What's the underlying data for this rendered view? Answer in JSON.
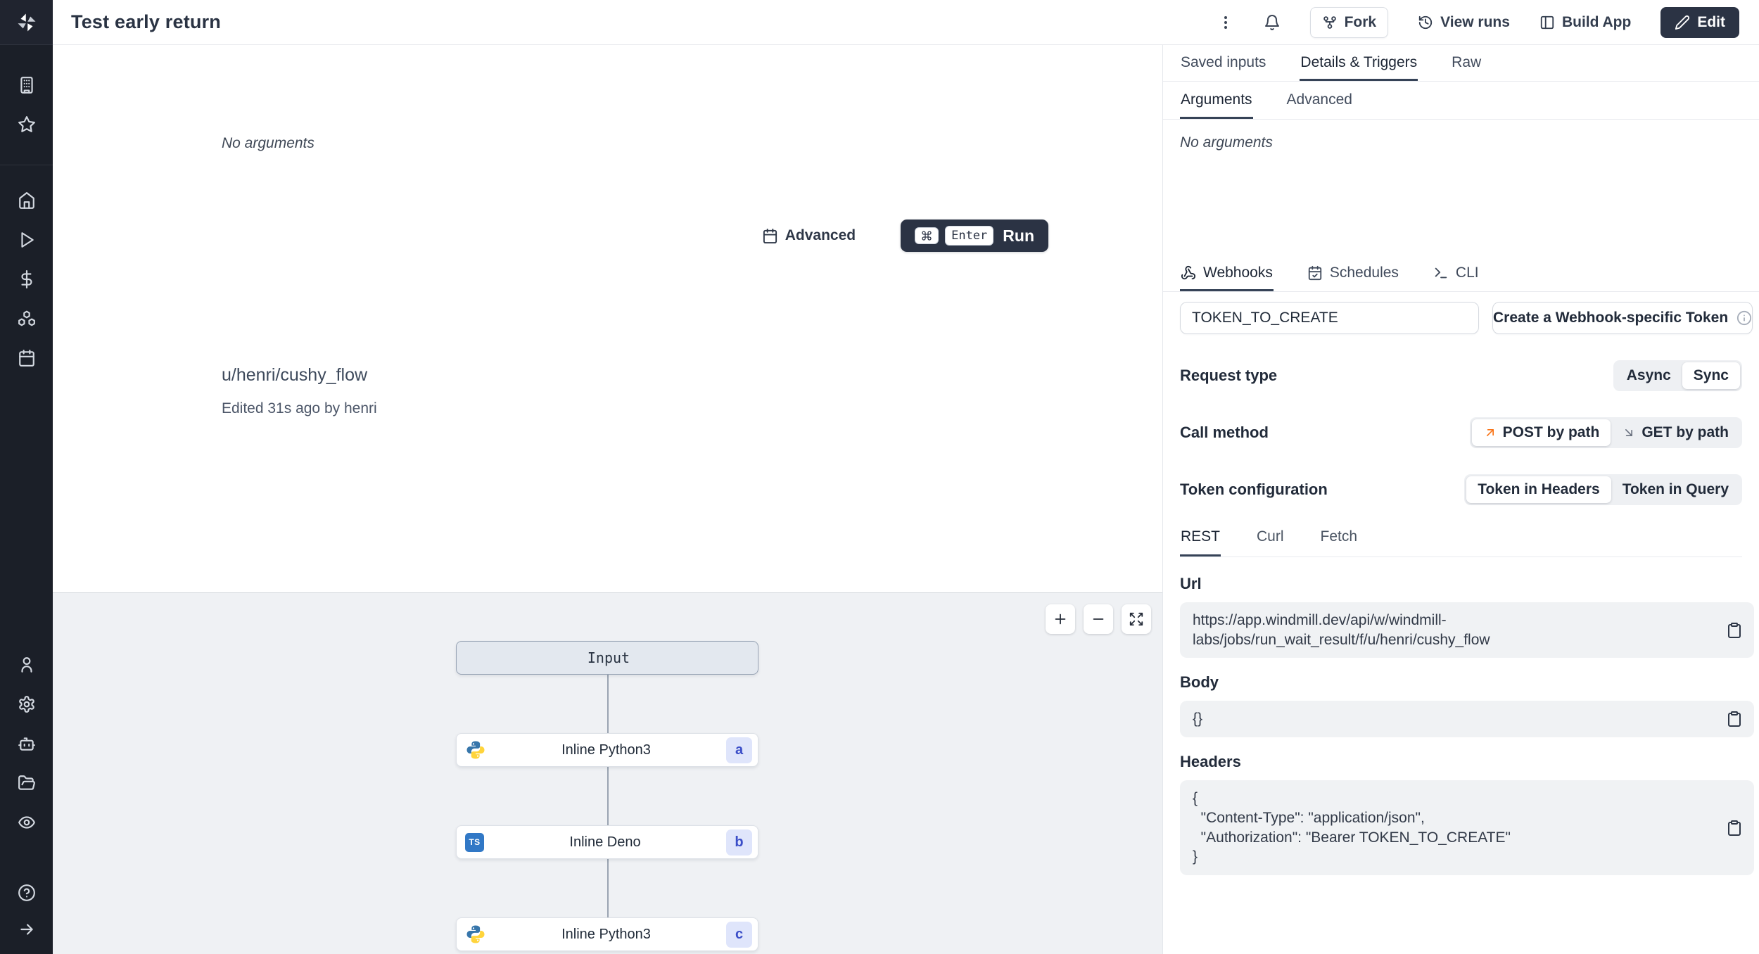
{
  "header": {
    "title": "Test early return",
    "fork_label": "Fork",
    "view_runs_label": "View runs",
    "build_app_label": "Build App",
    "edit_label": "Edit"
  },
  "sidebar": {
    "icons": [
      "windmill-logo",
      "building",
      "star",
      "home",
      "play",
      "dollar",
      "boxes",
      "calendar",
      "user",
      "gear",
      "robot",
      "folder",
      "eye",
      "help-circle",
      "arrow-right"
    ]
  },
  "main": {
    "no_arguments": "No arguments",
    "advanced_label": "Advanced",
    "run": {
      "cmd_key": "cmd",
      "enter_key": "Enter",
      "label": "Run"
    },
    "path": "u/henri/cushy_flow",
    "edited": "Edited 31s ago by henri",
    "flow": {
      "input_label": "Input",
      "nodes": [
        {
          "label": "Inline Python3",
          "badge": "a",
          "lang": "python"
        },
        {
          "label": "Inline Deno",
          "badge": "b",
          "lang": "typescript"
        },
        {
          "label": "Inline Python3",
          "badge": "c",
          "lang": "python"
        }
      ],
      "ts_glyph": "TS"
    }
  },
  "panel": {
    "tabs": [
      "Saved inputs",
      "Details & Triggers",
      "Raw"
    ],
    "active_tab": "Details & Triggers",
    "sub_tabs": [
      "Arguments",
      "Advanced"
    ],
    "active_sub_tab": "Arguments",
    "no_arguments": "No arguments",
    "trigger_tabs": [
      "Webhooks",
      "Schedules",
      "CLI"
    ],
    "active_trigger_tab": "Webhooks",
    "token_input_value": "TOKEN_TO_CREATE",
    "create_token_button": "Create a Webhook-specific Token",
    "request_type": {
      "label": "Request type",
      "options": [
        "Async",
        "Sync"
      ],
      "selected": "Sync"
    },
    "call_method": {
      "label": "Call method",
      "options": [
        "POST by path",
        "GET by path"
      ],
      "selected": "POST by path"
    },
    "token_config": {
      "label": "Token configuration",
      "options": [
        "Token in Headers",
        "Token in Query"
      ],
      "selected": "Token in Headers"
    },
    "code_tabs": [
      "REST",
      "Curl",
      "Fetch"
    ],
    "active_code_tab": "REST",
    "url": {
      "label": "Url",
      "value": "https://app.windmill.dev/api/w/windmill-labs/jobs/run_wait_result/f/u/henri/cushy_flow"
    },
    "body": {
      "label": "Body",
      "value": "{}"
    },
    "headers": {
      "label": "Headers",
      "value": "{\n  \"Content-Type\": \"application/json\",\n  \"Authorization\": \"Bearer TOKEN_TO_CREATE\"\n}"
    }
  },
  "colors": {
    "sidebar_bg": "#1b1f28",
    "accent_dark": "#2b3344",
    "canvas_bg": "#eff1f4",
    "badge_bg": "#dfe5fb",
    "badge_text": "#3b4ec8",
    "post_arrow": "#f97316",
    "ts_blue": "#3178c6"
  }
}
